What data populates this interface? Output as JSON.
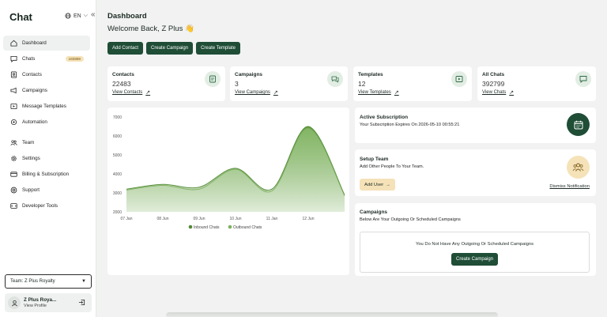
{
  "app": {
    "brand": "Chat",
    "language": "EN"
  },
  "sidebar": {
    "items": [
      {
        "label": "Dashboard",
        "icon": "home-icon"
      },
      {
        "label": "Chats",
        "icon": "chat-icon",
        "badge": "183889"
      },
      {
        "label": "Contacts",
        "icon": "contacts-icon"
      },
      {
        "label": "Campaigns",
        "icon": "campaign-icon"
      },
      {
        "label": "Message Templates",
        "icon": "template-icon"
      },
      {
        "label": "Automation",
        "icon": "automation-icon"
      },
      {
        "label": "Team",
        "icon": "team-icon"
      },
      {
        "label": "Settings",
        "icon": "gear-icon"
      },
      {
        "label": "Billing & Subscription",
        "icon": "card-icon"
      },
      {
        "label": "Support",
        "icon": "support-icon"
      },
      {
        "label": "Developer Tools",
        "icon": "developer-icon"
      }
    ],
    "team_select": "Team: Z Plus Royalty",
    "profile": {
      "name": "Z Plus Roya...",
      "sub": "View Profile"
    }
  },
  "header": {
    "title": "Dashboard",
    "welcome": "Welcome Back, Z Plus 👋"
  },
  "actions": {
    "add_contact": "Add Contact",
    "create_campaign": "Create Campaign",
    "create_template": "Create Template"
  },
  "stats": [
    {
      "label": "Contacts",
      "value": "22483",
      "link": "View Contacts"
    },
    {
      "label": "Campaigns",
      "value": "3",
      "link": "View Campaigns"
    },
    {
      "label": "Templates",
      "value": "12",
      "link": "View Templates"
    },
    {
      "label": "All Chats",
      "value": "392799",
      "link": "View Chats"
    }
  ],
  "subscription": {
    "title": "Active Subscription",
    "text": "Your Subscription Expires On 2026-05-10 00:55:21"
  },
  "setup_team": {
    "title": "Setup Team",
    "text": "Add Other People To Your Team.",
    "add_user": "Add User",
    "dismiss": "Dismiss Notification"
  },
  "campaigns_panel": {
    "title": "Campaigns",
    "text": "Below Are Your Outgoing Or Scheduled Campaigns",
    "empty": "You Do Not Have Any Outgoing Or Scheduled Campaigns",
    "button": "Create Campaign"
  },
  "colors": {
    "primary": "#1f4d36",
    "accent": "#f5e2b8",
    "chart_green": "#5e9a3f"
  },
  "chart_data": {
    "type": "area",
    "x": [
      "07 Jan",
      "08 Jun",
      "09 Jun",
      "10 Jun",
      "11 Jan",
      "12 Jun"
    ],
    "y_ticks": [
      2000,
      3000,
      4000,
      5000,
      6000,
      7000
    ],
    "ylim": [
      2000,
      7000
    ],
    "series": [
      {
        "name": "Inbound Chats",
        "values": [
          3200,
          3450,
          3300,
          4300,
          3200,
          6500,
          2900
        ]
      },
      {
        "name": "Outbound Chats",
        "values": [
          3150,
          3400,
          3200,
          4250,
          3100,
          6400,
          2850
        ]
      }
    ],
    "x_positions_index": [
      0,
      1,
      2,
      3,
      4,
      5,
      6
    ],
    "legend": "bottom"
  }
}
